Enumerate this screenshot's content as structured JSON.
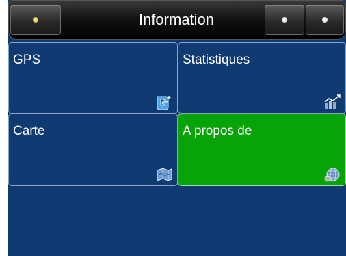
{
  "header": {
    "title": "Information",
    "home_icon": "home-dot-icon",
    "back_icon": "back-dot-icon",
    "menu_icon": "menu-dot-icon"
  },
  "tiles": [
    {
      "label": "GPS",
      "icon": "gps-signal-icon",
      "active": false
    },
    {
      "label": "Statistiques",
      "icon": "statistics-icon",
      "active": false
    },
    {
      "label": "Carte",
      "icon": "map-icon",
      "active": false
    },
    {
      "label": "A propos de",
      "icon": "about-globe-icon",
      "active": true
    }
  ],
  "colors": {
    "background": "#0f3a72",
    "active_tile": "#08a308",
    "header": "#141414"
  }
}
